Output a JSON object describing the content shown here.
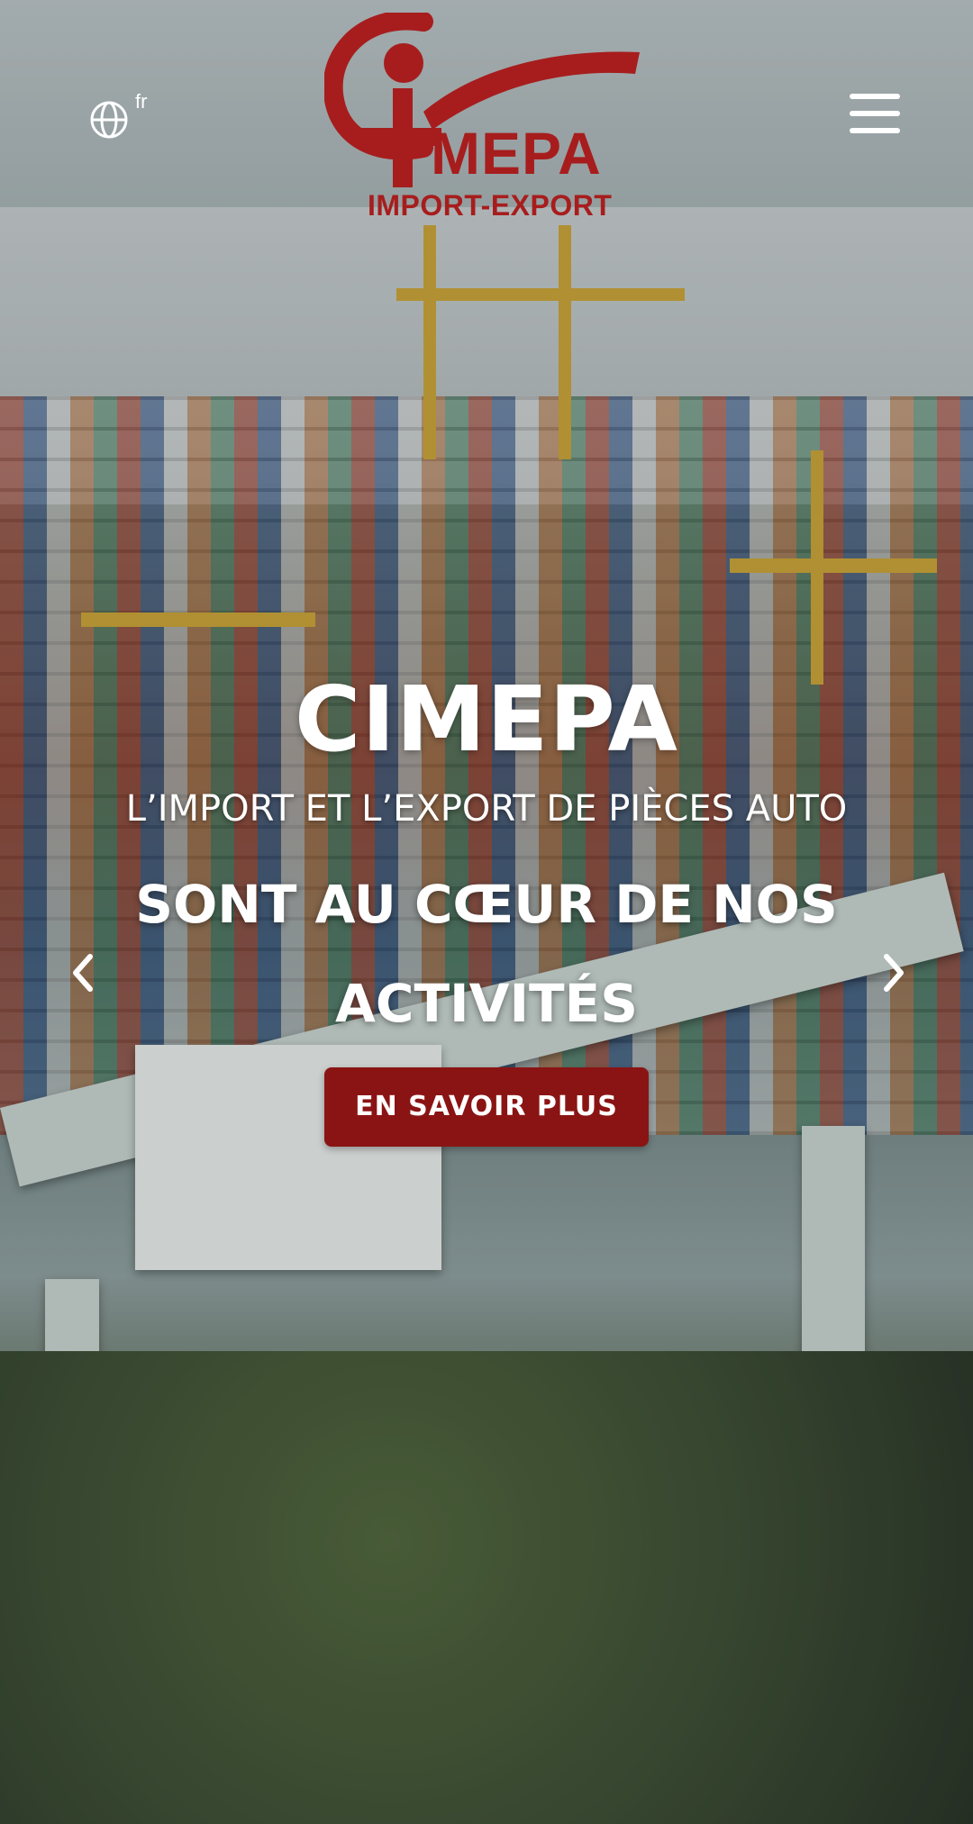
{
  "header": {
    "language": {
      "code": "fr",
      "icon": "globe-icon"
    },
    "logo": {
      "wordmark": "MEPA",
      "tagline": "IMPORT-EXPORT"
    },
    "menu": {
      "icon": "hamburger-menu-icon"
    }
  },
  "slide": {
    "title": "CIMEPA",
    "subtitle": "L’IMPORT ET L’EXPORT DE PIÈCES AUTO",
    "headline": "SONT AU CŒUR DE NOS ACTIVITÉS",
    "cta_label": "EN SAVOIR PLUS"
  },
  "carousel": {
    "prev_icon": "chevron-left-icon",
    "next_icon": "chevron-right-icon"
  },
  "colors": {
    "brand_red": "#A71D1D",
    "button_red": "#8A1414",
    "text_light": "#FFFFFF"
  }
}
